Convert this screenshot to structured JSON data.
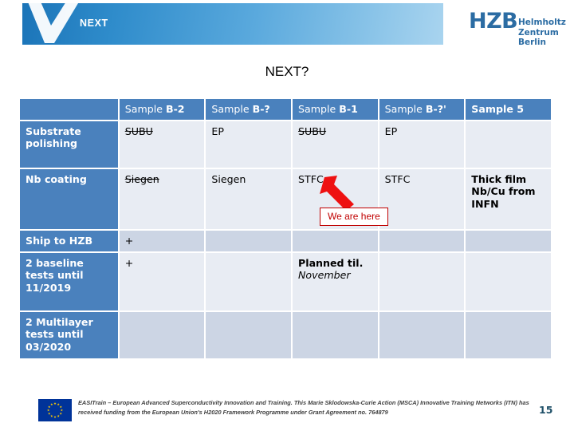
{
  "header": {
    "banner_label": "NEXT",
    "logo_mark": "HZB",
    "logo_line1": "Helmholtz",
    "logo_line2": "Zentrum Berlin",
    "banner_start_color": "#1b74b8",
    "banner_end_color": "#a9d4ef"
  },
  "slide": {
    "title": "NEXT?"
  },
  "table": {
    "corner_label": "",
    "columns": [
      {
        "prefix": "Sample ",
        "code": "B-2",
        "bold_all": false
      },
      {
        "prefix": "Sample ",
        "code": "B-?",
        "bold_all": false
      },
      {
        "prefix": "Sample ",
        "code": "B-1",
        "bold_all": false
      },
      {
        "prefix": "Sample ",
        "code": "B-?'",
        "bold_all": false
      },
      {
        "prefix": "Sample 5",
        "code": "",
        "bold_all": true
      }
    ],
    "rows": [
      {
        "label": "Substrate polishing",
        "shade": "light",
        "cells": [
          {
            "text": "SUBU",
            "strike": true,
            "align": "left"
          },
          {
            "text": "EP",
            "strike": false,
            "align": "left"
          },
          {
            "text": "SUBU",
            "strike": true,
            "align": "left"
          },
          {
            "text": "EP",
            "strike": false,
            "align": "left"
          },
          {
            "text": "",
            "strike": false,
            "align": "left"
          }
        ]
      },
      {
        "label": "Nb coating",
        "shade": "light",
        "cells": [
          {
            "text": "Siegen",
            "strike": true,
            "align": "left"
          },
          {
            "text": "Siegen",
            "strike": false,
            "align": "left"
          },
          {
            "text": "STFC",
            "strike": false,
            "align": "left"
          },
          {
            "text": "STFC",
            "strike": false,
            "align": "left"
          },
          {
            "text": "Thick film Nb/Cu from INFN",
            "strike": false,
            "align": "left",
            "bold": true
          }
        ]
      },
      {
        "label": "Ship to HZB",
        "shade": "dark",
        "cells": [
          {
            "text": "+",
            "strike": false,
            "align": "center"
          },
          {
            "text": "",
            "strike": false,
            "align": "left"
          },
          {
            "text": "",
            "strike": false,
            "align": "left"
          },
          {
            "text": "",
            "strike": false,
            "align": "left"
          },
          {
            "text": "",
            "strike": false,
            "align": "left"
          }
        ]
      },
      {
        "label": "2 baseline tests until 11/2019",
        "shade": "light",
        "cells": [
          {
            "text": "+",
            "strike": false,
            "align": "center"
          },
          {
            "text": "",
            "strike": false,
            "align": "left"
          },
          {
            "text": "",
            "strike": false,
            "align": "center",
            "special": "planned"
          },
          {
            "text": "",
            "strike": false,
            "align": "left"
          },
          {
            "text": "",
            "strike": false,
            "align": "left"
          }
        ]
      },
      {
        "label": "2 Multilayer tests until 03/2020",
        "shade": "dark",
        "cells": [
          {
            "text": "",
            "strike": false,
            "align": "left"
          },
          {
            "text": "",
            "strike": false,
            "align": "left"
          },
          {
            "text": "",
            "strike": false,
            "align": "left"
          },
          {
            "text": "",
            "strike": false,
            "align": "left"
          },
          {
            "text": "",
            "strike": false,
            "align": "left"
          }
        ]
      }
    ],
    "planned_line1": "Planned til.",
    "planned_line2": "November",
    "header_bg": "#4a81bd",
    "cell_light_bg": "#e8ecf3",
    "cell_dark_bg": "#ccd5e4"
  },
  "callout": {
    "text": "We are here",
    "color": "#c00000",
    "arrow_color": "#ee1111"
  },
  "footer": {
    "text": "EASITrain – European Advanced Superconductivity Innovation and Training. This Marie Sklodowska-Curie Action (MSCA) Innovative Training Networks (ITN) has received funding from the European Union's H2020 Framework Programme under Grant Agreement no. 764879",
    "page_number": "15",
    "eu_flag_bg": "#003399",
    "eu_star_color": "#FFCC00"
  }
}
